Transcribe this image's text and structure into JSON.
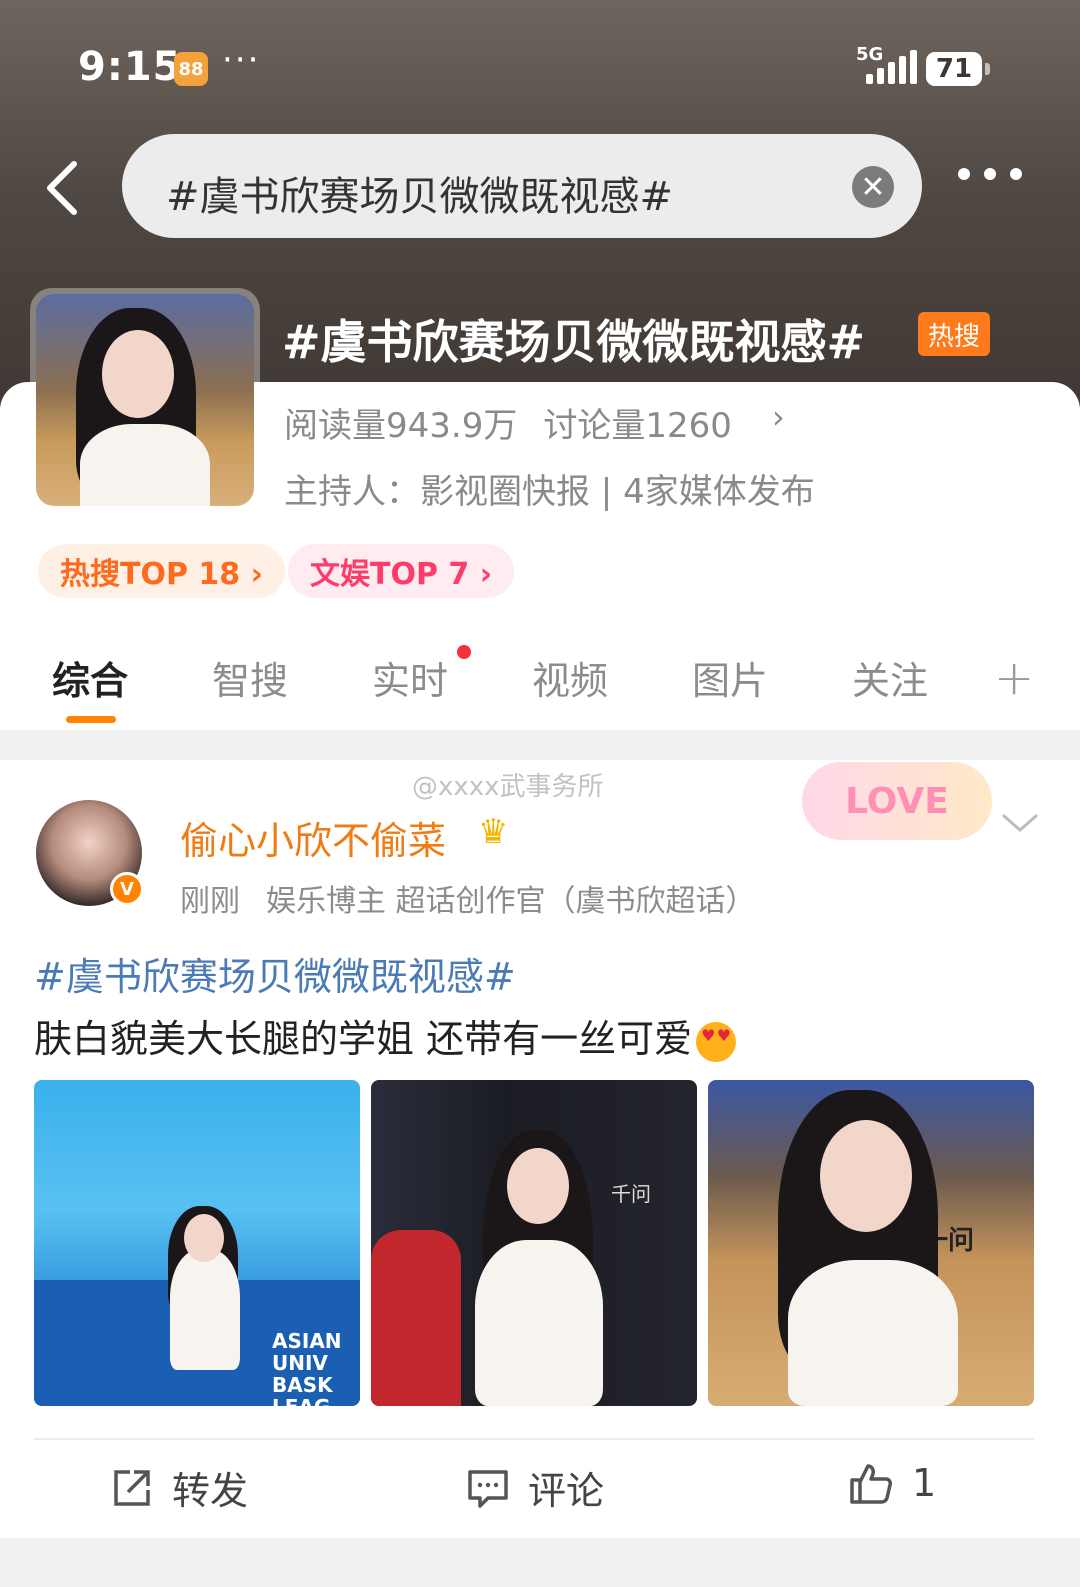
{
  "status_bar": {
    "time": "9:15",
    "app_badge": "88",
    "dots": "···",
    "network": "5G",
    "battery": "71"
  },
  "search": {
    "query": "#虞书欣赛场贝微微既视感#",
    "clear_icon": "✕"
  },
  "topic": {
    "title": "#虞书欣赛场贝微微既视感#",
    "hot_badge": "热搜",
    "reads": "阅读量943.9万",
    "discussions": "讨论量1260",
    "arrow": "›",
    "host": "主持人：影视圈快报 | 4家媒体发布",
    "rank_tags": [
      {
        "label": "热搜TOP 18 ›"
      },
      {
        "label": "文娱TOP 7 ›"
      }
    ]
  },
  "tabs": [
    {
      "label": "综合"
    },
    {
      "label": "智搜"
    },
    {
      "label": "实时"
    },
    {
      "label": "视频"
    },
    {
      "label": "图片"
    },
    {
      "label": "关注"
    }
  ],
  "tab_plus": "+",
  "post": {
    "watermark": "@xxxx武事务所",
    "sticker": "LOVE",
    "username": "偷心小欣不偷菜",
    "crown": "♛",
    "verify_mark": "V",
    "time": "刚刚",
    "tags": "娱乐博主 超话创作官（虞书欣超话）",
    "hashtag": "#虞书欣赛场贝微微既视感#",
    "text": "肤白貌美大长腿的学姐 还带有一丝可爱",
    "photo_texts": {
      "photo1": "ASIAN UNIV BASK LEAG",
      "photo2": "千问",
      "photo3": "一问"
    },
    "actions": {
      "repost": "转发",
      "comment": "评论",
      "like_count": "1"
    }
  },
  "colors": {
    "accent": "#ff8200",
    "username": "#f07b12",
    "hashtag": "#4a7bb7",
    "hot_badge": "#ff7a1a"
  }
}
